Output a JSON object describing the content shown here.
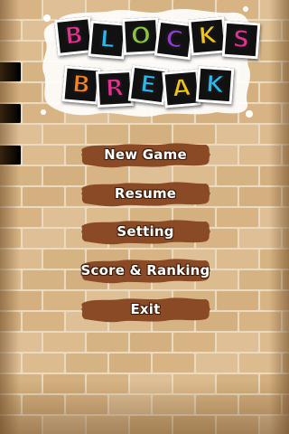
{
  "game": {
    "logo_text": "BLOCKS BREAK",
    "logo_rows": [
      [
        {
          "char": "B",
          "color": "#e0328f"
        },
        {
          "char": "L",
          "color": "#29b8ec"
        },
        {
          "char": "O",
          "color": "#8bc53f"
        },
        {
          "char": "C",
          "color": "#8b3fc4"
        },
        {
          "char": "K",
          "color": "#f0c419"
        },
        {
          "char": "S",
          "color": "#e0328f"
        }
      ],
      [
        {
          "char": "B",
          "color": "#f58220"
        },
        {
          "char": "R",
          "color": "#e0328f"
        },
        {
          "char": "E",
          "color": "#29b8ec"
        },
        {
          "char": "A",
          "color": "#f0c419"
        },
        {
          "char": "K",
          "color": "#29b8ec"
        }
      ]
    ]
  },
  "menu": {
    "items": [
      {
        "label": "New Game",
        "name": "new-game-button"
      },
      {
        "label": "Resume",
        "name": "resume-button"
      },
      {
        "label": "Setting",
        "name": "setting-button"
      },
      {
        "label": "Score & Ranking",
        "name": "score-ranking-button"
      },
      {
        "label": "Exit",
        "name": "exit-button"
      }
    ]
  },
  "colors": {
    "wall": "#d9b88a",
    "mortar": "#eadbc0",
    "button": "#8a4a25",
    "button_text": "#ffffff"
  }
}
